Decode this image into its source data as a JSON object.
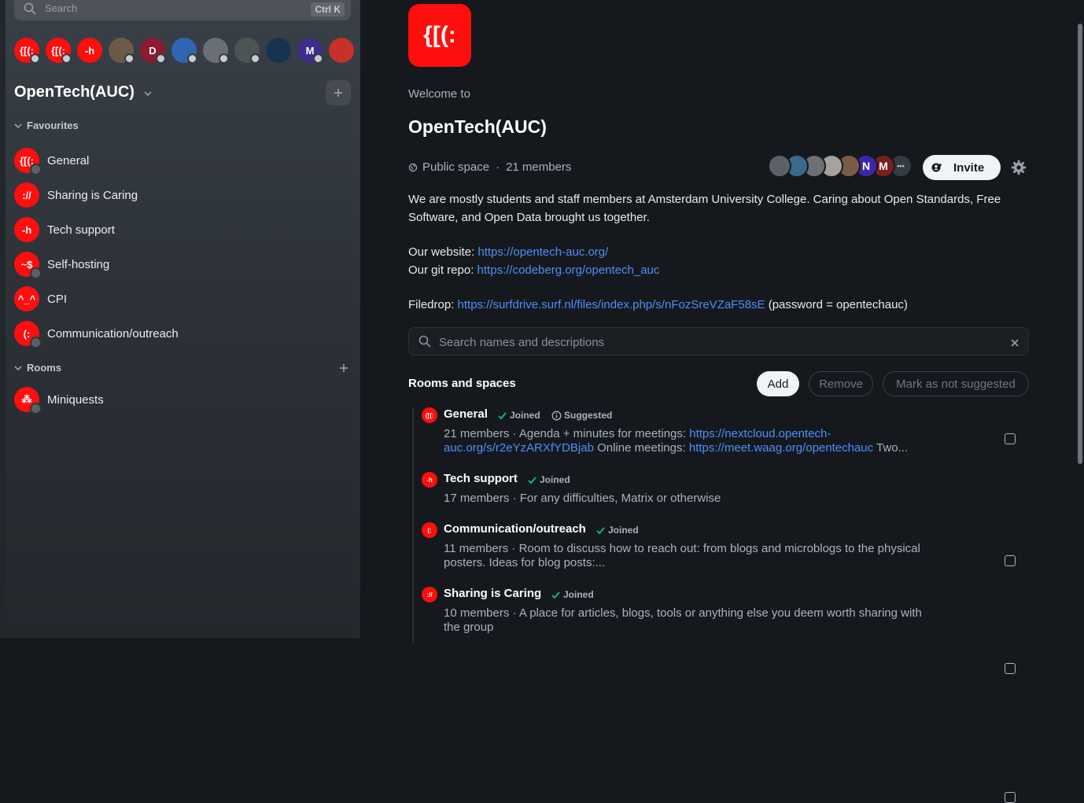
{
  "left": {
    "search": {
      "placeholder": "Search",
      "shortcut": "Ctrl K"
    },
    "space_bar": [
      {
        "name": "opentech-space",
        "text": "{[(:",
        "bg": "#ff0e0e",
        "status": "badge"
      },
      {
        "name": "opentech-space-2",
        "text": "{[(:",
        "bg": "#ff0e0e",
        "status": "badge"
      },
      {
        "name": "tech-support-space",
        "text": "-h",
        "bg": "#ff0e0e",
        "status": ""
      },
      {
        "name": "person-avatar",
        "text": "",
        "bg": "#6b5a48",
        "status": "dot"
      },
      {
        "name": "d-avatar",
        "text": "D",
        "bg": "#8b1a32",
        "status": "dot"
      },
      {
        "name": "gear-space-avatar",
        "text": "",
        "bg": "#2f66b3",
        "status": "badge"
      },
      {
        "name": "grey-photo-avatar",
        "text": "",
        "bg": "#6a6f75",
        "status": "dot"
      },
      {
        "name": "landscape-avatar",
        "text": "",
        "bg": "#4d5552",
        "status": "dot"
      },
      {
        "name": "green-creature-avatar",
        "text": "",
        "bg": "#16344f",
        "status": ""
      },
      {
        "name": "m-avatar",
        "text": "M",
        "bg": "#3f2d8c",
        "status": "dot"
      },
      {
        "name": "red-badge-avatar",
        "text": "",
        "bg": "#c8302a",
        "status": ""
      }
    ],
    "space_title": "OpenTech(AUC)",
    "favourites_label": "Favourites",
    "rooms_label": "Rooms",
    "favourites": [
      {
        "label": "General",
        "icon": "{[(:",
        "badge": true
      },
      {
        "label": "Sharing is Caring",
        "icon": "://",
        "badge": false
      },
      {
        "label": "Tech support",
        "icon": "-h",
        "badge": false
      },
      {
        "label": "Self-hosting",
        "icon": "~$",
        "badge": true
      },
      {
        "label": "CPI",
        "icon": "^_^",
        "badge": false
      },
      {
        "label": "Communication/outreach",
        "icon": "(:",
        "badge": true
      }
    ],
    "rooms": [
      {
        "label": "Miniquests",
        "icon": "⁂",
        "badge": true
      }
    ]
  },
  "main": {
    "logo_text": "{[(:",
    "welcome": "Welcome to",
    "title": "OpenTech(AUC)",
    "visibility": "Public space",
    "separator": "·",
    "members": "21 members",
    "facepile": [
      {
        "text": "",
        "bg": "#5c6168"
      },
      {
        "text": "",
        "bg": "#3b6a8a"
      },
      {
        "text": "",
        "bg": "#6d7176"
      },
      {
        "text": "",
        "bg": "#a7a29c"
      },
      {
        "text": "",
        "bg": "#7a5b47"
      },
      {
        "text": "N",
        "bg": "#3c27a8"
      },
      {
        "text": "M",
        "bg": "#7a1f1f"
      },
      {
        "text": "•••",
        "bg": "#353b42"
      }
    ],
    "invite_label": "Invite",
    "description": {
      "line1": "We are mostly students and staff members at Amsterdam University College. Caring about Open Standards, Free Software, and Open Data brought us together.",
      "website_prefix": "Our website: ",
      "website_url": "https://opentech-auc.org/",
      "git_prefix": "Our git repo: ",
      "git_url": "https://codeberg.org/opentech_auc",
      "filedrop_prefix": "Filedrop: ",
      "filedrop_url": "https://surfdrive.surf.nl/files/index.php/s/nFozSreVZaF58sE",
      "filedrop_suffix": " (password = opentechauc)"
    },
    "room_search_placeholder": "Search names and descriptions",
    "rooms_and_spaces": "Rooms and spaces",
    "btn_add": "Add",
    "btn_remove": "Remove",
    "btn_mark": "Mark as not suggested",
    "entries": [
      {
        "name": "General",
        "icon": "{[(:",
        "joined": "Joined",
        "suggested": "Suggested",
        "sub_prefix": "21 members · Agenda + minutes for meetings: ",
        "link1": "https://nextcloud.opentech-auc.org/s/r2eYzARXfYDBjab",
        "mid": " Online meetings: ",
        "link2": "https://meet.waag.org/opentechauc",
        "suffix": " Two..."
      },
      {
        "name": "Tech support",
        "icon": "-h",
        "joined": "Joined",
        "sub": "17 members · For any difficulties, Matrix or otherwise"
      },
      {
        "name": "Communication/outreach",
        "icon": "(:",
        "joined": "Joined",
        "sub": "11 members · Room to discuss how to reach out: from blogs and microblogs to the physical posters. Ideas for blog posts:..."
      },
      {
        "name": "Sharing is Caring",
        "icon": "://",
        "joined": "Joined",
        "sub": "10 members · A place for articles, blogs, tools or anything else you deem worth sharing with the group"
      }
    ]
  }
}
